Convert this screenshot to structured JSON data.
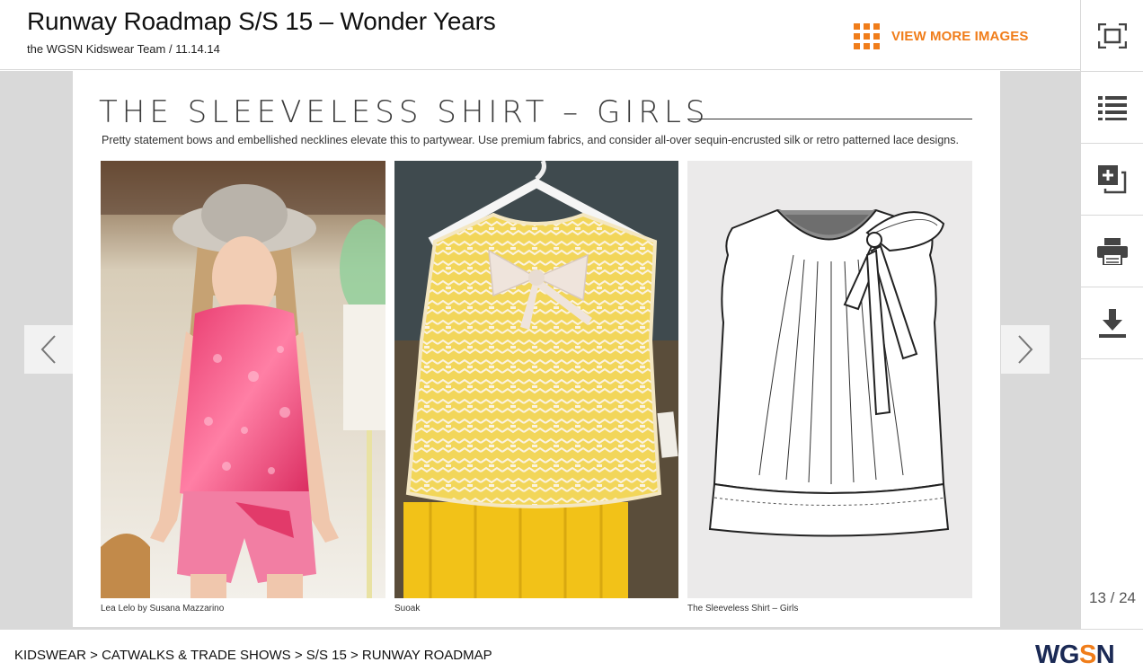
{
  "header": {
    "title": "Runway Roadmap S/S 15 – Wonder Years",
    "subtitle": "the WGSN Kidswear Team / 11.14.14",
    "view_more_label": "VIEW MORE IMAGES",
    "view_more_icon": "grid-icon",
    "accent_color": "#f07d1a"
  },
  "toolbar": {
    "items": [
      {
        "name": "fullscreen",
        "icon": "fullscreen-icon"
      },
      {
        "name": "list",
        "icon": "list-icon"
      },
      {
        "name": "add-to-board",
        "icon": "add-board-icon"
      },
      {
        "name": "print",
        "icon": "print-icon"
      },
      {
        "name": "download",
        "icon": "download-icon"
      }
    ],
    "page_counter": "13 / 24"
  },
  "slide": {
    "heading": "THE SLEEVELESS SHIRT – GIRLS",
    "description": "Pretty statement bows and embellished necklines elevate this to partywear. Use premium fabrics, and consider all-over sequin-encrusted silk or retro patterned lace designs.",
    "images": [
      {
        "caption": "Lea Lelo by Susana Mazzarino",
        "subject": "girl in pink sequin top and hat"
      },
      {
        "caption": "Suoak",
        "subject": "yellow patterned sleeveless top with bow on hanger"
      },
      {
        "caption": "The Sleeveless Shirt – Girls",
        "subject": "technical flat sketch of sleeveless shirt with bow"
      }
    ]
  },
  "navigation": {
    "prev_icon": "chevron-left-icon",
    "next_icon": "chevron-right-icon"
  },
  "footer": {
    "breadcrumb": "KIDSWEAR > CATWALKS & TRADE SHOWS > S/S 15 > RUNWAY ROADMAP",
    "logo_part1": "WG",
    "logo_part2": "S",
    "logo_part3": "N",
    "logo_navy": "#1b2a55",
    "logo_orange": "#f07d1a"
  }
}
